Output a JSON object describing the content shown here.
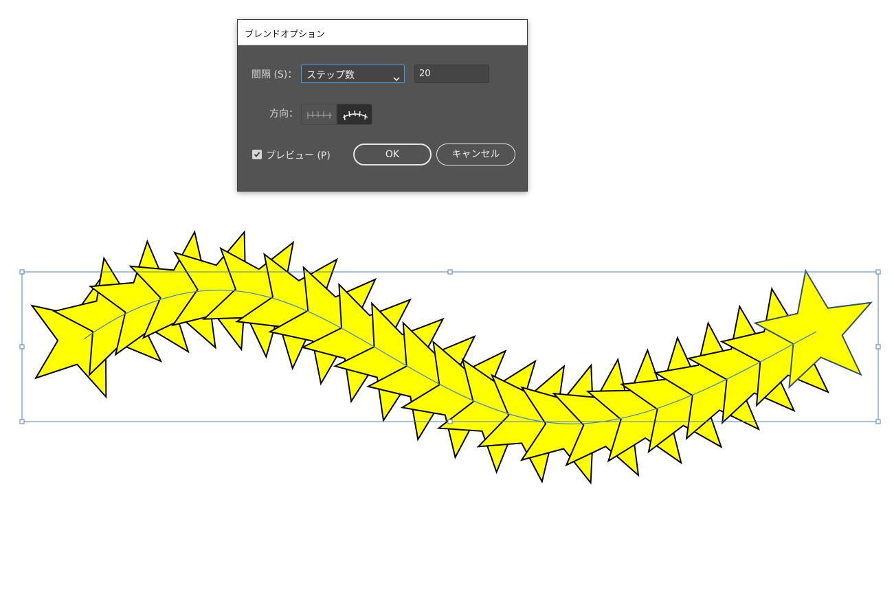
{
  "dialog": {
    "title": "ブレンドオプション",
    "spacing_label": "間隔 (S)：",
    "spacing_mode": "ステップ数",
    "spacing_value": "20",
    "orientation_label": "方向：",
    "orientation_options": [
      "align-to-page-icon",
      "align-to-path-icon"
    ],
    "orientation_selected": "align-to-path-icon",
    "preview_label": "プレビュー (P)",
    "preview_checked": true,
    "ok_label": "OK",
    "cancel_label": "キャンセル"
  },
  "canvas": {
    "star_fill": "#ffff00",
    "star_stroke": "#000000",
    "selection_color": "#4a7fc1",
    "blend_steps": 20,
    "spine_color": "#4a86c8"
  }
}
